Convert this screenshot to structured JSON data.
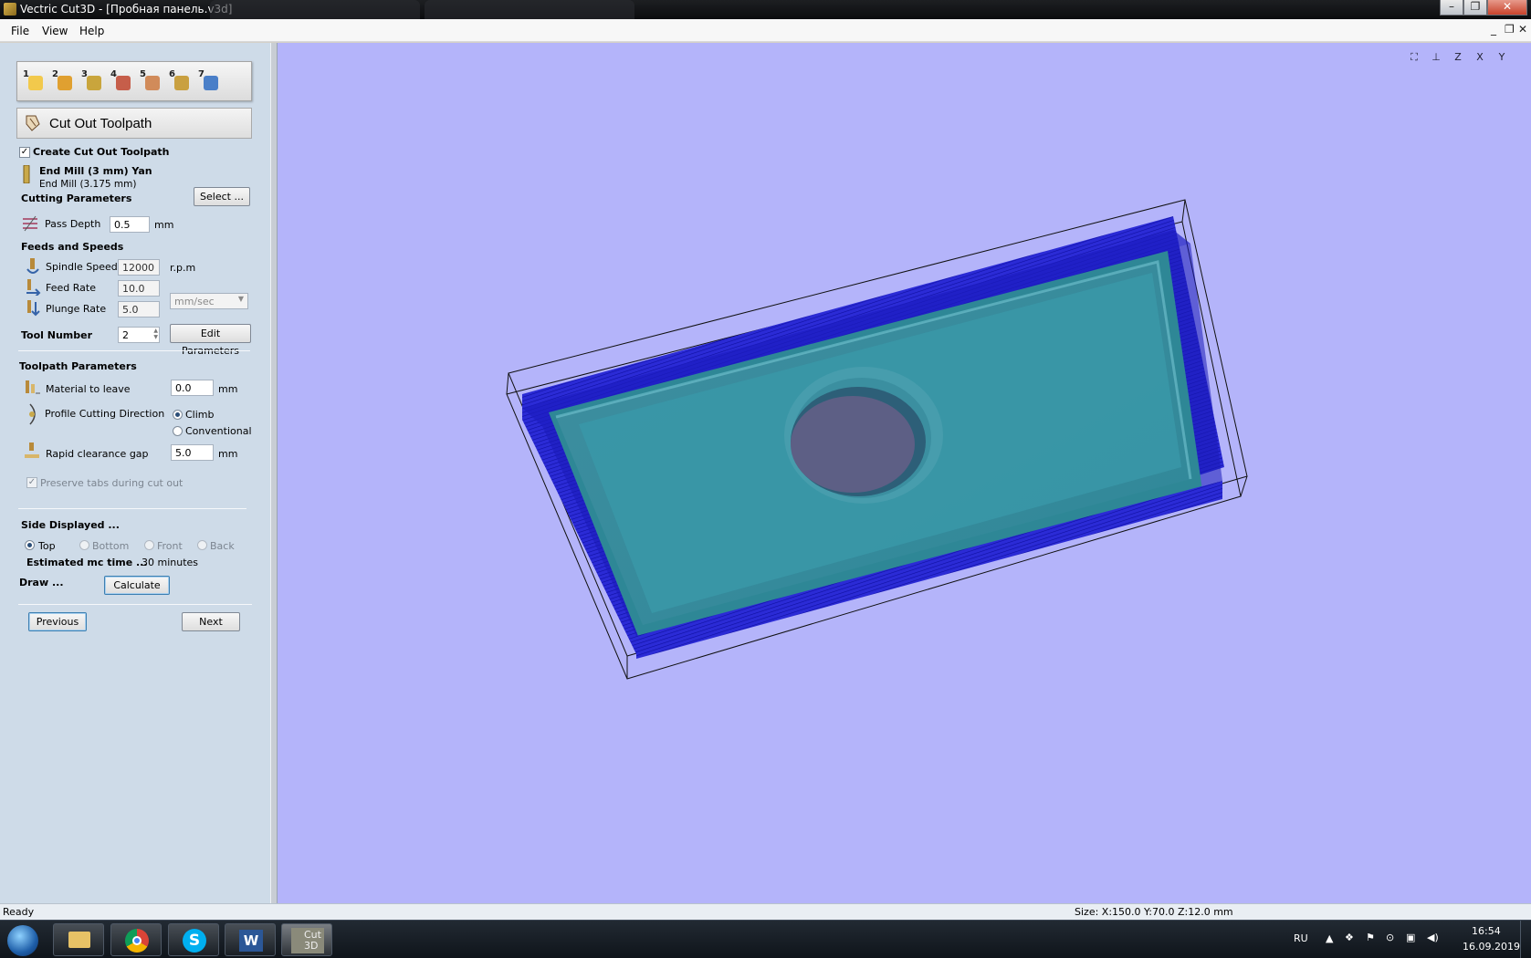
{
  "window": {
    "title": "Vectric Cut3D - [Пробная панель.v3d]"
  },
  "menu": {
    "items": [
      "File",
      "View",
      "Help"
    ]
  },
  "panel": {
    "steps": [
      "1",
      "2",
      "3",
      "4",
      "5",
      "6",
      "7"
    ],
    "header_title": "Cut Out Toolpath",
    "create_cutout_label": "Create Cut Out Toolpath",
    "tool_name": "End Mill (3 mm) Yan",
    "tool_desc": "End Mill (3.175 mm)",
    "select_button": "Select ...",
    "cutting_params_heading": "Cutting Parameters",
    "pass_depth_label": "Pass Depth",
    "pass_depth_value": "0.5",
    "pass_depth_unit": "mm",
    "feeds_heading": "Feeds and Speeds",
    "spindle_label": "Spindle Speed",
    "spindle_value": "12000",
    "spindle_unit": "r.p.m",
    "feed_label": "Feed Rate",
    "feed_value": "10.0",
    "plunge_label": "Plunge Rate",
    "plunge_value": "5.0",
    "rate_unit": "mm/sec",
    "tool_number_label": "Tool Number",
    "tool_number_value": "2",
    "edit_params_button": "Edit Parameters",
    "toolpath_params_heading": "Toolpath Parameters",
    "material_leave_label": "Material to leave",
    "material_leave_value": "0.0",
    "material_leave_unit": "mm",
    "profile_dir_label": "Profile Cutting Direction",
    "climb_label": "Climb",
    "conventional_label": "Conventional",
    "rapid_gap_label": "Rapid clearance gap",
    "rapid_gap_value": "5.0",
    "rapid_gap_unit": "mm",
    "preserve_tabs_label": "Preserve tabs during cut out",
    "side_heading": "Side Displayed ...",
    "side_top": "Top",
    "side_bottom": "Bottom",
    "side_front": "Front",
    "side_back": "Back",
    "est_time_label": "Estimated mc time ...",
    "est_time_value": "30 minutes",
    "draw_label": "Draw ...",
    "calculate_button": "Calculate",
    "previous_button": "Previous",
    "next_button": "Next"
  },
  "view_tools": [
    "fit-view",
    "iso-view",
    "z-view",
    "x-view",
    "y-view"
  ],
  "status": {
    "left": "Ready",
    "size": "Size: X:150.0 Y:70.0 Z:12.0 mm"
  },
  "taskbar": {
    "lang": "RU",
    "time": "16:54",
    "date": "16.09.2019",
    "cut3d_label_line1": "Cut",
    "cut3d_label_line2": "3D"
  },
  "colors": {
    "viewport_bg": "#b4b4fa",
    "material": "#3a98a8",
    "toolpath": "#1a1ac8",
    "panel_bg": "#cedbe8"
  }
}
